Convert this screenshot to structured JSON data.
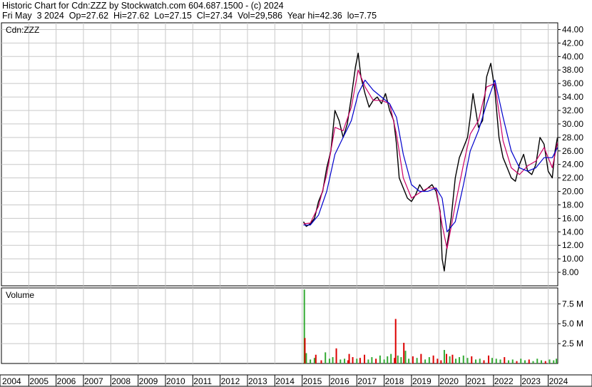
{
  "header": {
    "line1": "Historic Chart for Cdn:ZZZ by Stockwatch.com 604.687.1500 - (c) 2024",
    "line2": "Fri May  3 2024  Op=27.62  Hi=27.62  Lo=27.15  Cl=27.34  Vol=29,586  Year hi=42.36  lo=7.75"
  },
  "colors": {
    "price": "#000000",
    "ma_short": "#cc0066",
    "ma_long": "#0000cc",
    "vol_up": "#33aa33",
    "vol_down": "#dd0000",
    "grid": "#c8c8c8"
  },
  "chart_data": [
    {
      "type": "line",
      "panel_label": "Cdn:ZZZ",
      "ylim": [
        6,
        45
      ],
      "xlim": [
        2004.0,
        2024.35
      ],
      "y_ticks": [
        "44.00",
        "42.00",
        "40.00",
        "38.00",
        "36.00",
        "34.00",
        "32.00",
        "30.00",
        "28.00",
        "26.00",
        "24.00",
        "22.00",
        "20.00",
        "18.00",
        "16.00",
        "14.00",
        "12.00",
        "10.00",
        "8.00"
      ],
      "x_ticks": [
        "2004",
        "2005",
        "2006",
        "2007",
        "2008",
        "2009",
        "2010",
        "2011",
        "2012",
        "2013",
        "2014",
        "2015",
        "2016",
        "2017",
        "2018",
        "2019",
        "2020",
        "2021",
        "2022",
        "2023",
        "2024"
      ],
      "series": [
        {
          "x": [
            2015.05,
            2015.15,
            2015.3,
            2015.45,
            2015.6,
            2015.75,
            2015.9,
            2016.05,
            2016.2,
            2016.35,
            2016.5,
            2016.65,
            2016.8,
            2016.95,
            2017.05,
            2017.15,
            2017.3,
            2017.45,
            2017.6,
            2017.75,
            2017.9,
            2018.05,
            2018.2,
            2018.35,
            2018.45,
            2018.55,
            2018.7,
            2018.85,
            2019.0,
            2019.15,
            2019.3,
            2019.45,
            2019.6,
            2019.75,
            2019.9,
            2020.05,
            2020.12,
            2020.2,
            2020.3,
            2020.45,
            2020.6,
            2020.75,
            2020.9,
            2021.05,
            2021.15,
            2021.25,
            2021.35,
            2021.45,
            2021.6,
            2021.75,
            2021.9,
            2022.05,
            2022.2,
            2022.35,
            2022.5,
            2022.65,
            2022.8,
            2022.95,
            2023.1,
            2023.25,
            2023.4,
            2023.55,
            2023.7,
            2023.85,
            2024.0,
            2024.15,
            2024.25,
            2024.34
          ],
          "y": [
            15.5,
            14.8,
            15.2,
            16.0,
            18.5,
            20.0,
            23.5,
            26.0,
            32.0,
            30.5,
            28.0,
            30.0,
            34.0,
            38.5,
            40.5,
            37.0,
            34.5,
            32.5,
            33.5,
            34.0,
            33.0,
            34.5,
            32.0,
            30.5,
            27.0,
            22.0,
            20.5,
            19.0,
            18.5,
            19.5,
            21.0,
            20.0,
            20.5,
            21.0,
            20.0,
            17.0,
            10.0,
            8.2,
            12.0,
            16.0,
            22.0,
            25.0,
            26.5,
            28.0,
            31.0,
            34.5,
            32.0,
            29.5,
            30.5,
            37.0,
            39.0,
            35.0,
            28.0,
            25.0,
            23.5,
            22.0,
            21.5,
            24.0,
            25.5,
            23.0,
            22.5,
            24.0,
            28.0,
            27.0,
            23.0,
            22.0,
            26.0,
            28.0
          ]
        },
        {
          "name": "",
          "x": [
            2015.05,
            2015.3,
            2015.6,
            2015.9,
            2016.2,
            2016.5,
            2016.8,
            2017.05,
            2017.3,
            2017.6,
            2017.9,
            2018.2,
            2018.45,
            2018.7,
            2019.0,
            2019.3,
            2019.6,
            2019.9,
            2020.12,
            2020.3,
            2020.6,
            2020.9,
            2021.15,
            2021.45,
            2021.75,
            2022.05,
            2022.35,
            2022.65,
            2022.95,
            2023.25,
            2023.55,
            2023.85,
            2024.15,
            2024.34
          ],
          "y": [
            15.2,
            15.3,
            17.8,
            22.5,
            29.5,
            29.0,
            32.5,
            38.0,
            35.5,
            33.5,
            33.5,
            33.0,
            28.5,
            22.0,
            19.0,
            19.8,
            20.5,
            20.5,
            15.0,
            11.5,
            18.0,
            24.0,
            28.5,
            30.5,
            35.5,
            36.0,
            27.5,
            23.5,
            22.5,
            23.8,
            24.5,
            26.5,
            23.5,
            27.2
          ]
        },
        {
          "name": "",
          "x": [
            2015.05,
            2015.3,
            2015.6,
            2015.9,
            2016.2,
            2016.5,
            2016.8,
            2017.05,
            2017.3,
            2017.6,
            2017.9,
            2018.2,
            2018.45,
            2018.7,
            2019.0,
            2019.3,
            2019.6,
            2019.9,
            2020.12,
            2020.3,
            2020.6,
            2020.9,
            2021.15,
            2021.45,
            2021.75,
            2022.05,
            2022.35,
            2022.65,
            2022.95,
            2023.25,
            2023.55,
            2023.85,
            2024.15,
            2024.34
          ],
          "y": [
            15.0,
            15.0,
            16.5,
            20.0,
            25.5,
            28.0,
            30.5,
            34.5,
            36.5,
            35.0,
            34.0,
            33.0,
            31.0,
            25.5,
            21.0,
            20.0,
            20.0,
            20.5,
            19.0,
            14.0,
            15.5,
            21.0,
            26.0,
            29.0,
            33.0,
            36.5,
            31.0,
            26.0,
            23.5,
            23.0,
            23.5,
            25.0,
            25.0,
            26.5
          ]
        }
      ]
    },
    {
      "type": "bar",
      "panel_label": "Volume",
      "ylim": [
        0,
        9.5
      ],
      "y_ticks": [
        "7.5 M",
        "5.0 M",
        "2.5 M"
      ],
      "bars": [
        {
          "x": 2015.08,
          "v": 9.3,
          "c": "up"
        },
        {
          "x": 2015.1,
          "v": 3.2,
          "c": "down"
        },
        {
          "x": 2015.15,
          "v": 1.3,
          "c": "up"
        },
        {
          "x": 2015.3,
          "v": 0.5,
          "c": "up"
        },
        {
          "x": 2015.45,
          "v": 0.7,
          "c": "up"
        },
        {
          "x": 2015.5,
          "v": 1.1,
          "c": "down"
        },
        {
          "x": 2015.7,
          "v": 0.4,
          "c": "down"
        },
        {
          "x": 2015.85,
          "v": 1.4,
          "c": "up"
        },
        {
          "x": 2016.0,
          "v": 0.6,
          "c": "up"
        },
        {
          "x": 2016.12,
          "v": 0.8,
          "c": "up"
        },
        {
          "x": 2016.25,
          "v": 1.9,
          "c": "down"
        },
        {
          "x": 2016.4,
          "v": 0.5,
          "c": "up"
        },
        {
          "x": 2016.55,
          "v": 0.6,
          "c": "up"
        },
        {
          "x": 2016.68,
          "v": 0.4,
          "c": "down"
        },
        {
          "x": 2016.72,
          "v": 1.2,
          "c": "down"
        },
        {
          "x": 2016.85,
          "v": 0.8,
          "c": "down"
        },
        {
          "x": 2017.0,
          "v": 0.6,
          "c": "up"
        },
        {
          "x": 2017.12,
          "v": 0.7,
          "c": "down"
        },
        {
          "x": 2017.28,
          "v": 1.1,
          "c": "down"
        },
        {
          "x": 2017.42,
          "v": 0.5,
          "c": "up"
        },
        {
          "x": 2017.55,
          "v": 0.8,
          "c": "up"
        },
        {
          "x": 2017.7,
          "v": 0.6,
          "c": "down"
        },
        {
          "x": 2017.85,
          "v": 1.0,
          "c": "up"
        },
        {
          "x": 2018.0,
          "v": 0.5,
          "c": "up"
        },
        {
          "x": 2018.12,
          "v": 0.9,
          "c": "up"
        },
        {
          "x": 2018.25,
          "v": 1.2,
          "c": "up"
        },
        {
          "x": 2018.38,
          "v": 0.7,
          "c": "down"
        },
        {
          "x": 2018.42,
          "v": 5.6,
          "c": "down"
        },
        {
          "x": 2018.5,
          "v": 1.0,
          "c": "up"
        },
        {
          "x": 2018.62,
          "v": 0.8,
          "c": "up"
        },
        {
          "x": 2018.72,
          "v": 2.6,
          "c": "down"
        },
        {
          "x": 2018.78,
          "v": 1.6,
          "c": "up"
        },
        {
          "x": 2018.9,
          "v": 0.6,
          "c": "up"
        },
        {
          "x": 2019.05,
          "v": 0.9,
          "c": "down"
        },
        {
          "x": 2019.2,
          "v": 0.7,
          "c": "up"
        },
        {
          "x": 2019.35,
          "v": 1.2,
          "c": "down"
        },
        {
          "x": 2019.5,
          "v": 0.5,
          "c": "up"
        },
        {
          "x": 2019.65,
          "v": 0.8,
          "c": "up"
        },
        {
          "x": 2019.8,
          "v": 1.0,
          "c": "down"
        },
        {
          "x": 2019.95,
          "v": 0.6,
          "c": "down"
        },
        {
          "x": 2020.08,
          "v": 0.4,
          "c": "down"
        },
        {
          "x": 2020.2,
          "v": 1.7,
          "c": "up"
        },
        {
          "x": 2020.28,
          "v": 1.2,
          "c": "down"
        },
        {
          "x": 2020.4,
          "v": 0.9,
          "c": "up"
        },
        {
          "x": 2020.5,
          "v": 1.1,
          "c": "down"
        },
        {
          "x": 2020.62,
          "v": 0.6,
          "c": "up"
        },
        {
          "x": 2020.75,
          "v": 0.8,
          "c": "up"
        },
        {
          "x": 2020.9,
          "v": 1.0,
          "c": "up"
        },
        {
          "x": 2021.05,
          "v": 0.7,
          "c": "up"
        },
        {
          "x": 2021.2,
          "v": 0.9,
          "c": "down"
        },
        {
          "x": 2021.35,
          "v": 0.5,
          "c": "up"
        },
        {
          "x": 2021.5,
          "v": 0.6,
          "c": "up"
        },
        {
          "x": 2021.65,
          "v": 0.4,
          "c": "down"
        },
        {
          "x": 2021.82,
          "v": 1.0,
          "c": "down"
        },
        {
          "x": 2021.95,
          "v": 0.7,
          "c": "up"
        },
        {
          "x": 2022.1,
          "v": 0.6,
          "c": "up"
        },
        {
          "x": 2022.25,
          "v": 0.5,
          "c": "up"
        },
        {
          "x": 2022.4,
          "v": 0.8,
          "c": "down"
        },
        {
          "x": 2022.55,
          "v": 0.4,
          "c": "up"
        },
        {
          "x": 2022.7,
          "v": 0.5,
          "c": "up"
        },
        {
          "x": 2022.85,
          "v": 0.3,
          "c": "down"
        },
        {
          "x": 2023.0,
          "v": 0.6,
          "c": "up"
        },
        {
          "x": 2023.15,
          "v": 0.4,
          "c": "up"
        },
        {
          "x": 2023.3,
          "v": 0.5,
          "c": "down"
        },
        {
          "x": 2023.45,
          "v": 0.3,
          "c": "up"
        },
        {
          "x": 2023.6,
          "v": 0.6,
          "c": "up"
        },
        {
          "x": 2023.75,
          "v": 0.4,
          "c": "up"
        },
        {
          "x": 2023.9,
          "v": 0.3,
          "c": "down"
        },
        {
          "x": 2024.05,
          "v": 0.5,
          "c": "up"
        },
        {
          "x": 2024.2,
          "v": 0.4,
          "c": "up"
        },
        {
          "x": 2024.3,
          "v": 0.6,
          "c": "up"
        }
      ]
    }
  ]
}
